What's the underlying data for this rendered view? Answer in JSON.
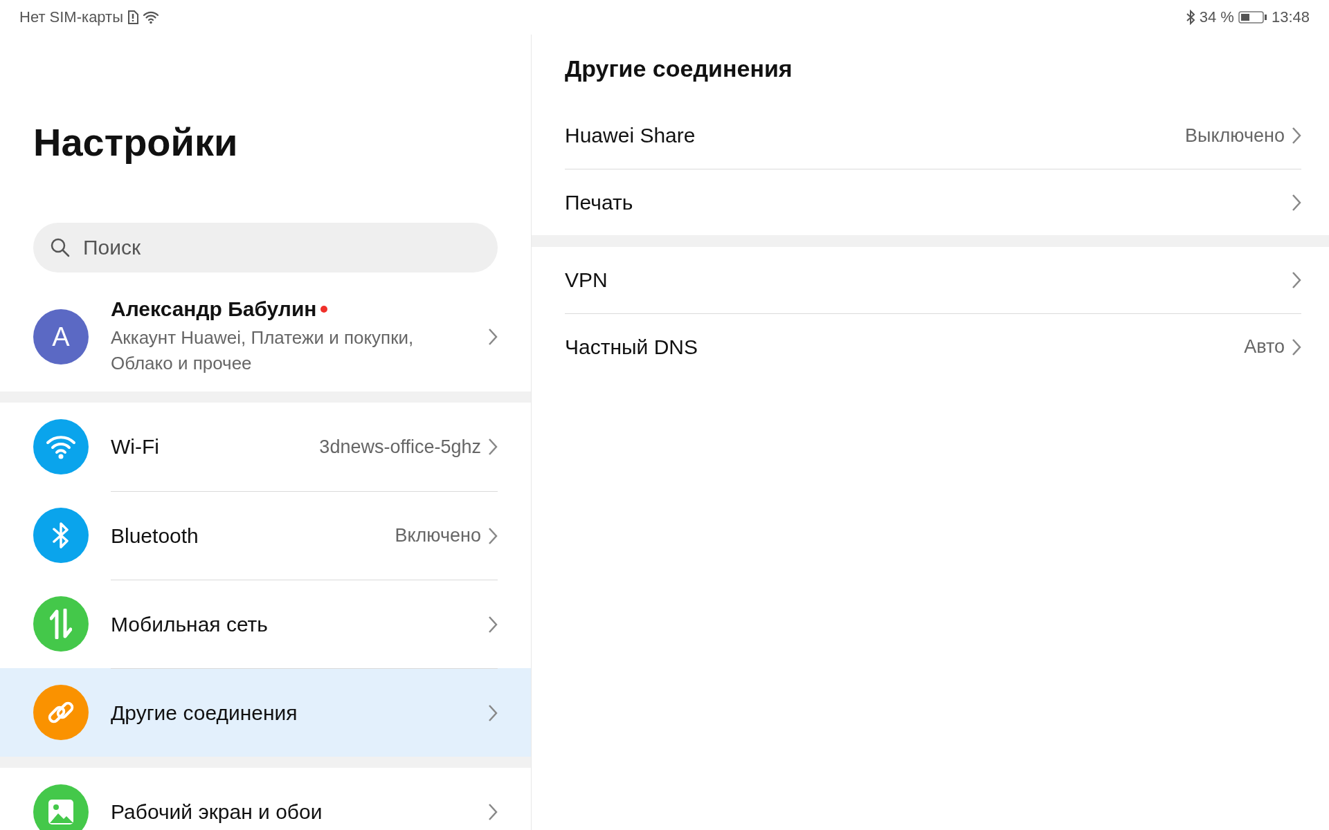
{
  "status_bar": {
    "carrier": "Нет SIM-карты",
    "battery_percent": "34 %",
    "time": "13:48"
  },
  "sidebar": {
    "title": "Настройки",
    "search": {
      "placeholder": "Поиск"
    },
    "account": {
      "initial": "A",
      "name": "Александр Бабулин",
      "unread": true,
      "subtitle": "Аккаунт Huawei, Платежи и покупки, Облако и прочее"
    },
    "groups": [
      [
        {
          "label": "Wi-Fi",
          "value": "3dnews-office-5ghz",
          "color": "#0aa4ec",
          "selected": false
        },
        {
          "label": "Bluetooth",
          "value": "Включено",
          "color": "#0aa4ec",
          "selected": false
        },
        {
          "label": "Мобильная сеть",
          "color": "#44c84a",
          "selected": false
        },
        {
          "label": "Другие соединения",
          "color": "#fa9200",
          "selected": true
        }
      ],
      [
        {
          "label": "Рабочий экран и обои",
          "color": "#44c84a",
          "selected": false
        }
      ]
    ]
  },
  "detail": {
    "title": "Другие соединения",
    "groups": [
      [
        {
          "label": "Huawei Share",
          "value": "Выключено"
        },
        {
          "label": "Печать"
        }
      ],
      [
        {
          "label": "VPN"
        },
        {
          "label": "Частный DNS",
          "value": "Авто"
        }
      ]
    ]
  }
}
